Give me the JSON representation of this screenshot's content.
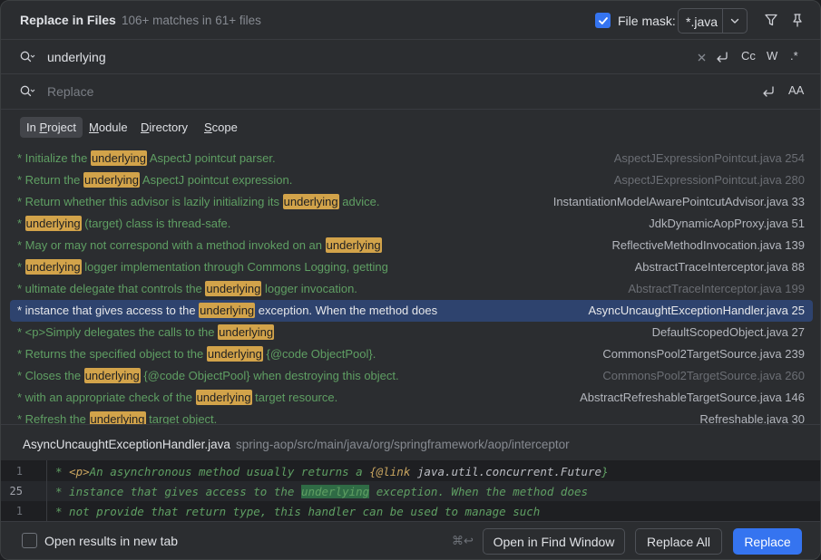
{
  "header": {
    "title": "Replace in Files",
    "matches": "106+ matches in 61+ files",
    "file_mask_label": "File mask:",
    "file_mask_value": "*.java",
    "file_mask_checked": true
  },
  "search": {
    "query": "underlying",
    "options": [
      "Cc",
      "W",
      ".*"
    ]
  },
  "replace": {
    "placeholder": "Replace",
    "option": "AA"
  },
  "scope_tabs": [
    {
      "label": "In Project",
      "mnemonic": "P",
      "selected": true
    },
    {
      "label": "Module",
      "mnemonic": "M",
      "selected": false
    },
    {
      "label": "Directory",
      "mnemonic": "D",
      "selected": false
    },
    {
      "label": "Scope",
      "mnemonic": "S",
      "selected": false
    }
  ],
  "results": [
    {
      "pre": "* Initialize the ",
      "match": "underlying",
      "post": " AspectJ pointcut parser.",
      "file": "AspectJExpressionPointcut.java",
      "line": "254",
      "dim": true
    },
    {
      "pre": "* Return the ",
      "match": "underlying",
      "post": " AspectJ pointcut expression.",
      "file": "AspectJExpressionPointcut.java",
      "line": "280",
      "dim": true
    },
    {
      "pre": "* Return whether this advisor is lazily initializing its ",
      "match": "underlying",
      "post": " advice.",
      "file": "InstantiationModelAwarePointcutAdvisor.java",
      "line": "33",
      "dim": false
    },
    {
      "pre": "* ",
      "match": "underlying",
      "post": " (target) class is thread-safe.",
      "file": "JdkDynamicAopProxy.java",
      "line": "51",
      "dim": false
    },
    {
      "pre": "* May or may not correspond with a method invoked on an ",
      "match": "underlying",
      "post": "",
      "file": "ReflectiveMethodInvocation.java",
      "line": "139",
      "dim": false
    },
    {
      "pre": "* ",
      "match": "underlying",
      "post": " logger implementation through Commons Logging, getting",
      "file": "AbstractTraceInterceptor.java",
      "line": "88",
      "dim": false
    },
    {
      "pre": "* ultimate delegate that controls the ",
      "match": "underlying",
      "post": " logger invocation.",
      "file": "AbstractTraceInterceptor.java",
      "line": "199",
      "dim": true
    },
    {
      "pre": "* instance that gives access to the ",
      "match": "underlying",
      "post": " exception. When the method does",
      "file": "AsyncUncaughtExceptionHandler.java",
      "line": "25",
      "dim": false,
      "selected": true
    },
    {
      "pre": "* <p>Simply delegates the calls to the ",
      "match": "underlying",
      "post": "",
      "file": "DefaultScopedObject.java",
      "line": "27",
      "dim": false
    },
    {
      "pre": "* Returns the specified object to the ",
      "match": "underlying",
      "post": " {@code ObjectPool}.",
      "file": "CommonsPool2TargetSource.java",
      "line": "239",
      "dim": false
    },
    {
      "pre": "* Closes the ",
      "match": "underlying",
      "post": " {@code ObjectPool} when destroying this object.",
      "file": "CommonsPool2TargetSource.java",
      "line": "260",
      "dim": true
    },
    {
      "pre": "* with an appropriate check of the ",
      "match": "underlying",
      "post": " target resource.",
      "file": "AbstractRefreshableTargetSource.java",
      "line": "146",
      "dim": false
    },
    {
      "pre": "* Refresh the ",
      "match": "underlying",
      "post": " target object.",
      "file": "Refreshable.java",
      "line": "30",
      "dim": false
    }
  ],
  "preview": {
    "file": "AsyncUncaughtExceptionHandler.java",
    "path": "spring-aop/src/main/java/org/springframework/aop/interceptor",
    "lines": [
      {
        "num": "1",
        "text_a": "* ",
        "tag": "<p>",
        "text_b": "An asynchronous method usually returns a ",
        "link": "{@link ",
        "plain": "java.util.concurrent.Future",
        "end": "}"
      },
      {
        "num": "25",
        "pre": "* instance that gives access to the ",
        "match": "underlying",
        "post": " exception. When the method does"
      },
      {
        "num": "1",
        "text": "* not provide that return type, this handler can be used to manage such"
      }
    ]
  },
  "footer": {
    "open_in_new_tab": "Open results in new tab",
    "shortcut": "⌘↩",
    "open_find_window": "Open in Find Window",
    "replace_all": "Replace All",
    "replace": "Replace"
  },
  "colors": {
    "accent": "#3574f0",
    "match_highlight": "#d2a34a",
    "selection": "#2e436e",
    "comment_green": "#5f9f63"
  }
}
